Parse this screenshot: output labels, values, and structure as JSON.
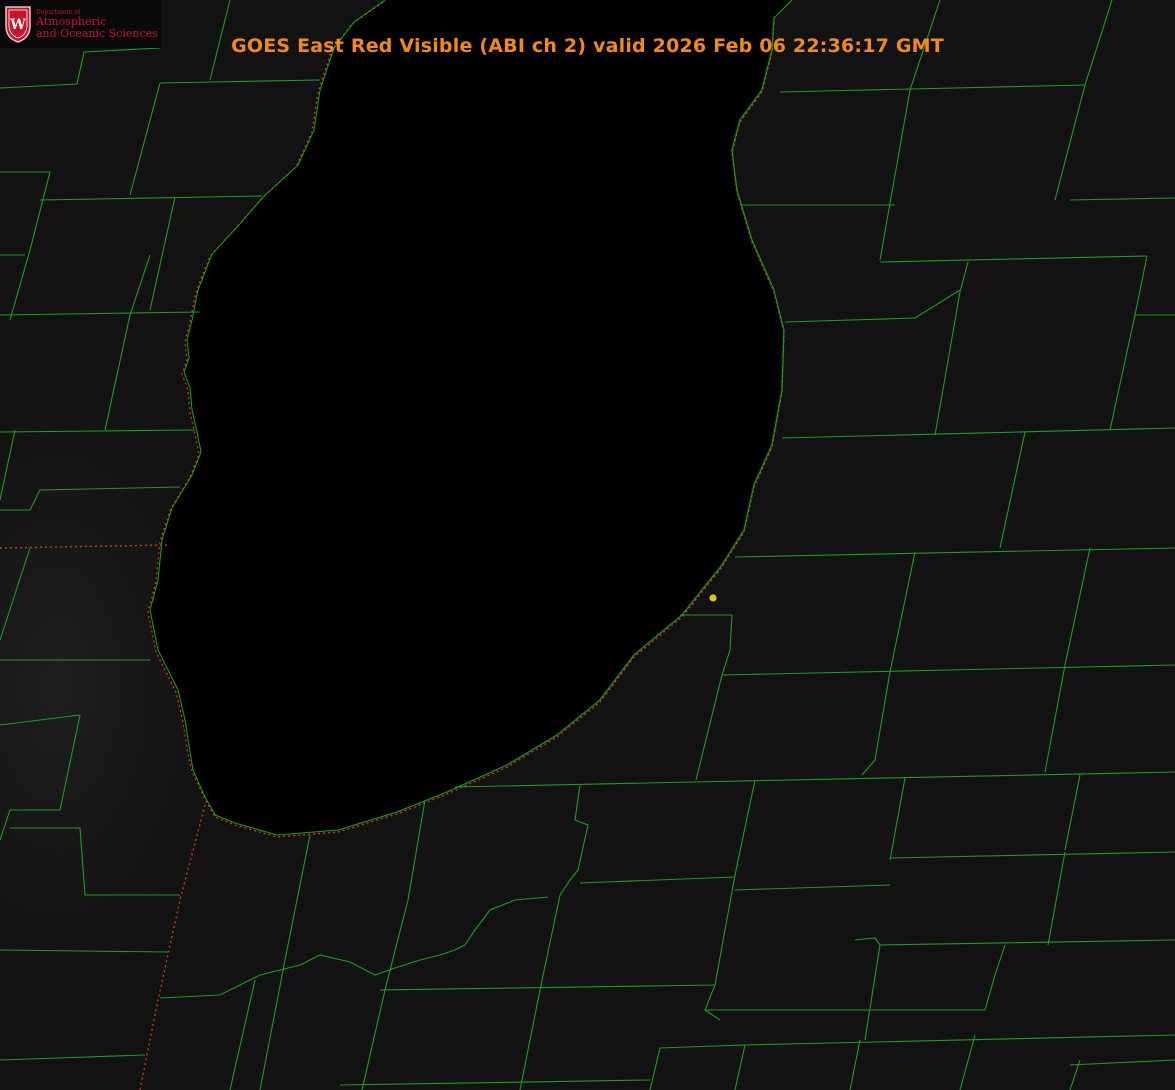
{
  "title": "GOES East Red Visible (ABI ch 2) valid 2026 Feb 06 22:36:17 GMT",
  "logo": {
    "department": "Department of",
    "line1": "Atmospheric",
    "line2": "and Oceanic Sciences",
    "crest_letter": "W",
    "crest_color": "#c5152f"
  },
  "colors": {
    "background": "#0c0c0c",
    "lake": "#000000",
    "county_lines": "#1f9b1f",
    "state_line_dotted": "#cc3b1a",
    "title": "#f08a1c",
    "marker": "#d6c81c"
  },
  "icons": {
    "marker": "yellow-dot-marker-icon",
    "crest": "university-crest-icon"
  }
}
